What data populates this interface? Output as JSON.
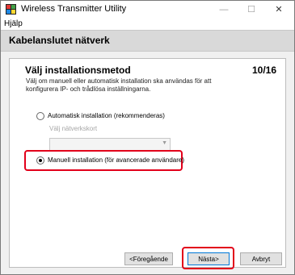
{
  "window": {
    "title": "Wireless Transmitter Utility"
  },
  "menu": {
    "items": [
      {
        "label": "Hjälp"
      }
    ]
  },
  "header": {
    "title": "Kabelanslutet nätverk"
  },
  "step": {
    "title": "Välj installationsmetod",
    "counter": "10/16",
    "description": "Välj om manuell eller automatisk installation ska användas för att konfigurera IP- och trådlösa inställningarna."
  },
  "options": [
    {
      "label": "Automatisk installation (rekommenderas)",
      "selected": false
    },
    {
      "label": "Manuell installation (för avancerade användare)",
      "selected": true
    }
  ],
  "network_card": {
    "label": "Välj nätverkskort",
    "value": ""
  },
  "buttons": {
    "back": "<Föregående",
    "next": "Nästa>",
    "cancel": "Avbryt"
  },
  "colors": {
    "highlight": "#e2001a",
    "header_bg": "#d9d9d9"
  }
}
